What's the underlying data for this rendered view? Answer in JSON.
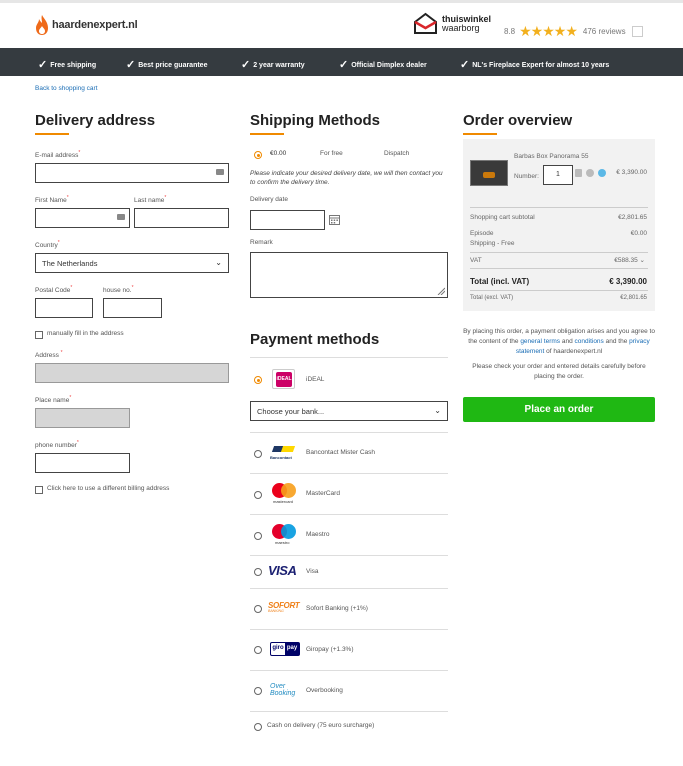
{
  "header": {
    "logo_text": "haardenexpert.nl",
    "trust_name_1": "thuiswinkel",
    "trust_name_2": "waarborg",
    "rating_score": "8.8",
    "stars": "★★★★★",
    "reviews": "476 reviews"
  },
  "usp": [
    "Free shipping",
    "Best price guarantee",
    "2 year warranty",
    "Official Dimplex dealer",
    "NL's Fireplace Expert for almost 10 years"
  ],
  "back_link": "Back to shopping cart",
  "delivery": {
    "title": "Delivery address",
    "email_label": "E-mail address",
    "first_name_label": "First Name",
    "last_name_label": "Last name",
    "country_label": "Country",
    "country_value": "The Netherlands",
    "postal_label": "Postal Code",
    "house_label": "house no.",
    "manual_label": "manually fill in the address",
    "address_label": "Address",
    "place_label": "Place name",
    "phone_label": "phone number",
    "billing_label": "Click here to use a different billing address",
    "required_mark": "*"
  },
  "shipping": {
    "title": "Shipping Methods",
    "price": "€0.00",
    "free": "For free",
    "dispatch": "Dispatch",
    "note": "Please indicate your desired delivery date, we will then contact you to confirm the delivery time.",
    "date_label": "Delivery date",
    "remark_label": "Remark"
  },
  "payment": {
    "title": "Payment methods",
    "ideal": "iDEAL",
    "ideal_logo": "iDEAL",
    "bank_placeholder": "Choose your bank...",
    "methods": [
      {
        "name": "Bancontact Mister Cash",
        "logo": "Bancontact"
      },
      {
        "name": "MasterCard",
        "logo": "mastercard"
      },
      {
        "name": "Maestro",
        "logo": "maestro"
      },
      {
        "name": "Visa",
        "logo": "VISA"
      },
      {
        "name": "Sofort Banking (+1%)",
        "logo": "SOFORT",
        "logo_sub": "BANKING"
      },
      {
        "name": "Giropay (+1.3%)",
        "logo": "giro",
        "logo_b": "pay"
      },
      {
        "name": "Overbooking",
        "logo": "Over",
        "logo_b": "Booking"
      }
    ],
    "cod": "Cash on delivery (75 euro surcharge)"
  },
  "overview": {
    "title": "Order overview",
    "product_name": "Barbas Box Panorama 55",
    "number_label": "Number:",
    "qty": "1",
    "product_price": "€ 3,390.00",
    "subtotal_label": "Shopping cart subtotal",
    "subtotal_value": "€2,801.65",
    "episode_label": "Episode",
    "episode_value": "€0.00",
    "shipping_label": "Shipping - Free",
    "vat_label": "VAT",
    "vat_value": "€588.35",
    "total_label": "Total (incl. VAT)",
    "total_value": "€ 3,390.00",
    "total_ex_label": "Total (excl. VAT)",
    "total_ex_value": "€2,801.65"
  },
  "legal": {
    "p1a": "By placing this order, a payment obligation arises and you agree to the content of the ",
    "terms": "general terms",
    "and": " and ",
    "conditions": "conditions",
    "p1b": " and the ",
    "privacy": "privacy statement",
    "p1c": " of haardenexpert.nl",
    "p2": "Please check your order and entered details carefully before placing the order."
  },
  "place_order": "Place an order",
  "colors": {
    "accent": "#f08a00",
    "button": "#1fb813",
    "bar": "#353b40",
    "link": "#1a6db5"
  }
}
